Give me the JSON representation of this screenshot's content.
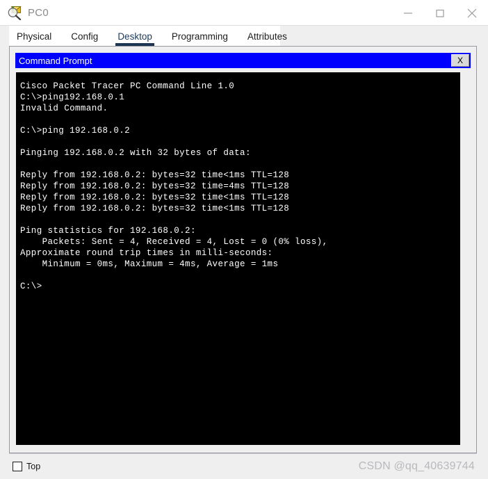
{
  "window": {
    "title": "PC0",
    "icon": "packet-tracer-magnifier-icon",
    "minimize_label": "minimize-icon",
    "maximize_label": "maximize-icon",
    "close_label": "close-icon"
  },
  "tabs": [
    {
      "label": "Physical",
      "active": false
    },
    {
      "label": "Config",
      "active": false
    },
    {
      "label": "Desktop",
      "active": true
    },
    {
      "label": "Programming",
      "active": false
    },
    {
      "label": "Attributes",
      "active": false
    }
  ],
  "command_prompt": {
    "title": "Command Prompt",
    "close_button_label": "X",
    "terminal": {
      "lines": [
        "Cisco Packet Tracer PC Command Line 1.0",
        "C:\\>ping192.168.0.1",
        "Invalid Command.",
        "",
        "C:\\>ping 192.168.0.2",
        "",
        "Pinging 192.168.0.2 with 32 bytes of data:",
        "",
        "Reply from 192.168.0.2: bytes=32 time<1ms TTL=128",
        "Reply from 192.168.0.2: bytes=32 time=4ms TTL=128",
        "Reply from 192.168.0.2: bytes=32 time<1ms TTL=128",
        "Reply from 192.168.0.2: bytes=32 time<1ms TTL=128",
        "",
        "Ping statistics for 192.168.0.2:",
        "    Packets: Sent = 4, Received = 4, Lost = 0 (0% loss),",
        "Approximate round trip times in milli-seconds:",
        "    Minimum = 0ms, Maximum = 4ms, Average = 1ms",
        "",
        "C:\\>"
      ],
      "text": "Cisco Packet Tracer PC Command Line 1.0\nC:\\>ping192.168.0.1\nInvalid Command.\n\nC:\\>ping 192.168.0.2\n\nPinging 192.168.0.2 with 32 bytes of data:\n\nReply from 192.168.0.2: bytes=32 time<1ms TTL=128\nReply from 192.168.0.2: bytes=32 time=4ms TTL=128\nReply from 192.168.0.2: bytes=32 time<1ms TTL=128\nReply from 192.168.0.2: bytes=32 time<1ms TTL=128\n\nPing statistics for 192.168.0.2:\n    Packets: Sent = 4, Received = 4, Lost = 0 (0% loss),\nApproximate round trip times in milli-seconds:\n    Minimum = 0ms, Maximum = 4ms, Average = 1ms\n\nC:\\>",
      "stats": {
        "target": "192.168.0.2",
        "packets_sent": 4,
        "packets_received": 4,
        "packets_lost": 0,
        "loss_percent": "0%",
        "bytes": 32,
        "ttl": 128,
        "minimum_ms": "0ms",
        "maximum_ms": "4ms",
        "average_ms": "1ms"
      }
    }
  },
  "bottom_bar": {
    "top_checkbox_label": "Top",
    "top_checkbox_checked": false,
    "watermark": "CSDN @qq_40639744"
  },
  "colors": {
    "cmd_title_blue": "#0000fe",
    "terminal_bg": "#000000",
    "terminal_fg": "#ffffff",
    "active_tab": "#1b3553",
    "panel_bg": "#efeff0"
  }
}
